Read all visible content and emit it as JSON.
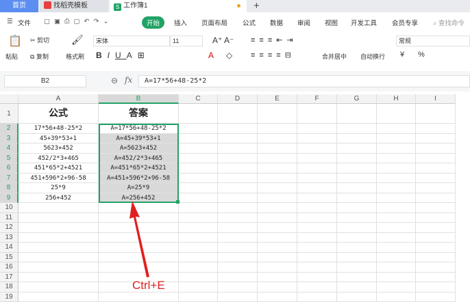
{
  "tabs": [
    {
      "label": "首页"
    },
    {
      "label": "找稻壳模板"
    },
    {
      "label": "工作簿1"
    }
  ],
  "menu": {
    "file": "文件",
    "items": [
      "开始",
      "插入",
      "页面布局",
      "公式",
      "数据",
      "审阅",
      "视图",
      "开发工具",
      "会员专享"
    ],
    "search": "查找命令"
  },
  "ribbon": {
    "paste": "粘贴",
    "cut": "剪切",
    "copy": "复制",
    "format_painter": "格式刷",
    "font": "宋体",
    "size": "11",
    "merge": "合并居中",
    "wrap": "自动换行",
    "number_format": "常规",
    "currency": "¥",
    "percent": "%"
  },
  "formula_bar": {
    "name_box": "B2",
    "fx": "fx",
    "value": "A=17*56+48-25*2"
  },
  "columns": [
    "A",
    "B",
    "C",
    "D",
    "E",
    "F",
    "G",
    "H",
    "I"
  ],
  "header_row": {
    "a": "公式",
    "b": "答案"
  },
  "rows": [
    {
      "a": "17*56+48-25*2",
      "b": "A=17*56+48-25*2"
    },
    {
      "a": "45+39*53+1",
      "b": "A=45+39*53+1"
    },
    {
      "a": "5623+452",
      "b": "A=5623+452"
    },
    {
      "a": "452/2*3+465",
      "b": "A=452/2*3+465"
    },
    {
      "a": "451*65*2+4521",
      "b": "A=451*65*2+4521"
    },
    {
      "a": "451+596*2+96-58",
      "b": "A=451+596*2+96-58"
    },
    {
      "a": "25*9",
      "b": "A=25*9"
    },
    {
      "a": "256+452",
      "b": "A=256+452"
    }
  ],
  "row_numbers": [
    "1",
    "2",
    "3",
    "4",
    "5",
    "6",
    "7",
    "8",
    "9",
    "10",
    "11",
    "12",
    "13",
    "14",
    "15",
    "16",
    "17",
    "18",
    "19"
  ],
  "annotation": "Ctrl+E",
  "colors": {
    "accent": "#21a366",
    "annotation": "#e02020"
  }
}
